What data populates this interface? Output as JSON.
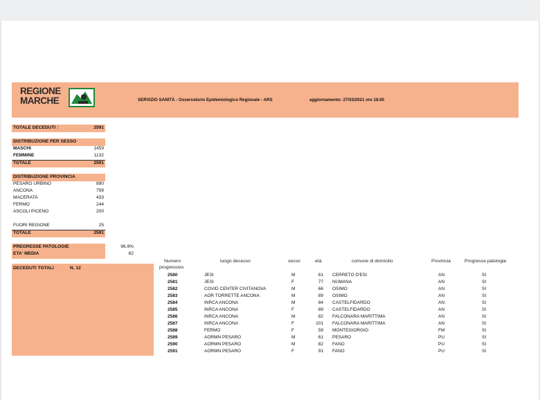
{
  "header": {
    "logo_line1": "REGIONE",
    "logo_line2": "MARCHE",
    "service": "SERVIZIO SANITÀ - Osservatorio Epidemiologico Regionale - ARS",
    "update": "aggiornamento: 27/03/2021 ore 18.00"
  },
  "totals": {
    "deceduti_label": "TOTALE DECEDUTI :",
    "deceduti_value": "2591"
  },
  "sesso": {
    "title": "DISTRIBUZIONE PER SESSO",
    "maschi_label": "MASCHI",
    "maschi_value": "1459",
    "femmine_label": "FEMMINE",
    "femmine_value": "1132",
    "totale_label": "TOTALE",
    "totale_value": "2591"
  },
  "provincia": {
    "title": "DISTRIBUZIONE  PROVINCIA",
    "items": [
      {
        "label": "PESARO URBINO",
        "value": "890"
      },
      {
        "label": "ANCONA",
        "value": "799"
      },
      {
        "label": "MACERATA",
        "value": "433"
      },
      {
        "label": "FERMO",
        "value": "244"
      },
      {
        "label": "ASCOLI PICENO",
        "value": "200"
      }
    ],
    "fuori_label": "FUORI REGIONE",
    "fuori_value": "25",
    "totale_label": "TOTALE",
    "totale_value": "2591"
  },
  "stats": {
    "patologie_label": "PREGRESSE PATOLOGIE",
    "patologie_value": "96,9%",
    "eta_label": "ETA' MEDIA",
    "eta_value": "82"
  },
  "deceduti_totali": {
    "label": "DECEDUTI TOTALI",
    "count": "N.  12"
  },
  "table": {
    "headers": {
      "numero": "Numero",
      "progressivo": "progressivo",
      "luogo": "luogo decesso",
      "sesso": "sesso",
      "eta": "età",
      "comune": "comune di domicilio",
      "provincia": "Provincia",
      "patologie": "Progresse patologie"
    },
    "rows": [
      {
        "prog": "2580",
        "luogo": "JESI",
        "sesso": "M",
        "eta": "61",
        "comune": "CERRETO D'ESI",
        "prov": "AN",
        "pato": "SI"
      },
      {
        "prog": "2581",
        "luogo": "JESI",
        "sesso": "F",
        "eta": "77",
        "comune": "NUMANA",
        "prov": "AN",
        "pato": "SI"
      },
      {
        "prog": "2582",
        "luogo": "COVID CENTER CIVITANOVA",
        "sesso": "M",
        "eta": "66",
        "comune": "OSIMO",
        "prov": "AN",
        "pato": "SI"
      },
      {
        "prog": "2583",
        "luogo": "AOR TORRETTE ANCONA",
        "sesso": "M",
        "eta": "89",
        "comune": "OSIMO",
        "prov": "AN",
        "pato": "SI"
      },
      {
        "prog": "2584",
        "luogo": "INRCA ANCONA",
        "sesso": "M",
        "eta": "84",
        "comune": "CASTELFIDARDO",
        "prov": "AN",
        "pato": "SI"
      },
      {
        "prog": "2585",
        "luogo": "INRCA ANCONA",
        "sesso": "F",
        "eta": "89",
        "comune": "CASTELFIDARDO",
        "prov": "AN",
        "pato": "SI"
      },
      {
        "prog": "2586",
        "luogo": "INRCA ANCONA",
        "sesso": "M",
        "eta": "82",
        "comune": "FALCONARA MARITTIMA",
        "prov": "AN",
        "pato": "SI"
      },
      {
        "prog": "2587",
        "luogo": "INRCA ANCONA",
        "sesso": "F",
        "eta": "101",
        "comune": "FALCONARA MARITTIMA",
        "prov": "AN",
        "pato": "SI"
      },
      {
        "prog": "2588",
        "luogo": "FERMO",
        "sesso": "F",
        "eta": "59",
        "comune": "MONTEGIORGIO",
        "prov": "FM",
        "pato": "SI"
      },
      {
        "prog": "2589",
        "luogo": "AORMN PESARO",
        "sesso": "M",
        "eta": "61",
        "comune": "PESARO",
        "prov": "PU",
        "pato": "SI"
      },
      {
        "prog": "2590",
        "luogo": "AORMN PESARO",
        "sesso": "M",
        "eta": "82",
        "comune": "FANO",
        "prov": "PU",
        "pato": "SI"
      },
      {
        "prog": "2591",
        "luogo": "AORMN PESARO",
        "sesso": "F",
        "eta": "91",
        "comune": "FANO",
        "prov": "PU",
        "pato": "SI"
      }
    ]
  },
  "colors": {
    "band": "#f6b28d",
    "logo_green": "#1f8a3a"
  }
}
